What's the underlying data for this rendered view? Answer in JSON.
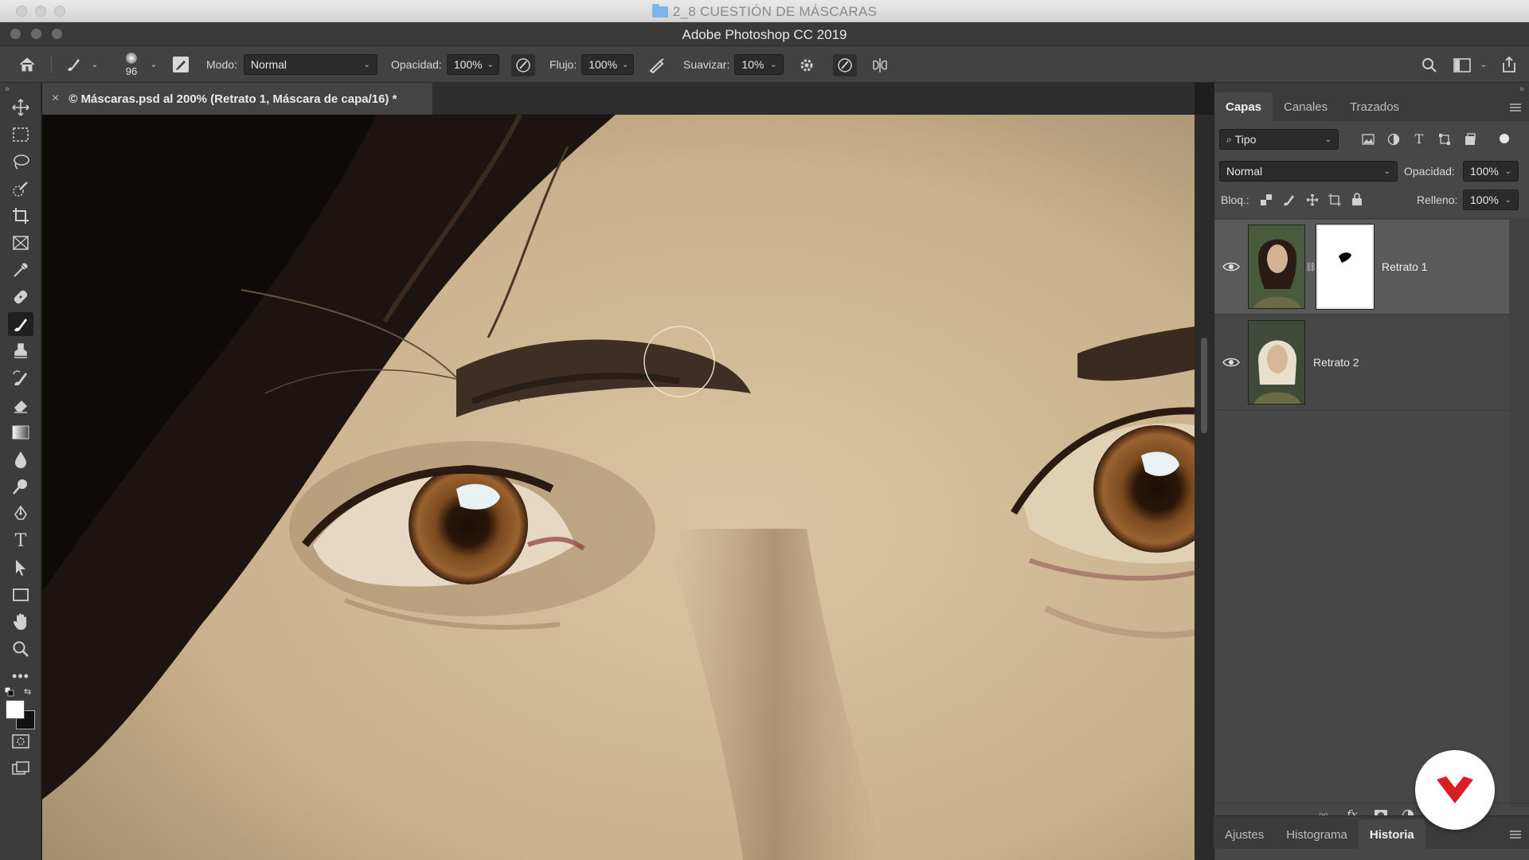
{
  "window": {
    "folder_title": "2_8 CUESTIÓN DE MÁSCARAS",
    "app_title": "Adobe Photoshop CC 2019"
  },
  "options_bar": {
    "brush_size": "96",
    "mode_label": "Modo:",
    "mode_value": "Normal",
    "opacity_label": "Opacidad:",
    "opacity_value": "100%",
    "flow_label": "Flujo:",
    "flow_value": "100%",
    "smoothing_label": "Suavizar:",
    "smoothing_value": "10%"
  },
  "document": {
    "tab_title": "© Máscaras.psd al 200% (Retrato 1, Máscara de capa/16) *",
    "close_glyph": "×"
  },
  "tools": [
    "move",
    "marquee",
    "lasso",
    "quick-selection",
    "crop",
    "frame",
    "eyedropper",
    "healing",
    "brush",
    "stamp",
    "history-brush",
    "eraser",
    "gradient",
    "blur",
    "dodge",
    "pen",
    "type",
    "path-selection",
    "rectangle",
    "hand",
    "zoom",
    "more"
  ],
  "layers_panel": {
    "tabs": [
      "Capas",
      "Canales",
      "Trazados"
    ],
    "active_tab": "Capas",
    "filter_label": "Tipo",
    "blend_mode": "Normal",
    "opacity_label": "Opacidad:",
    "opacity_value": "100%",
    "lock_label": "Bloq.:",
    "fill_label": "Relleno:",
    "fill_value": "100%",
    "layers": [
      {
        "name": "Retrato 1",
        "visible": true,
        "has_mask": true,
        "selected": true
      },
      {
        "name": "Retrato 2",
        "visible": true,
        "has_mask": false,
        "selected": false
      }
    ]
  },
  "bottom_tabs": {
    "tabs": [
      "Ajustes",
      "Histograma",
      "Historia"
    ],
    "active_tab": "Historia"
  },
  "colors": {
    "accent_logo": "#d81e25",
    "panel_bg": "#3b3b3b",
    "selected_row": "#525252"
  }
}
